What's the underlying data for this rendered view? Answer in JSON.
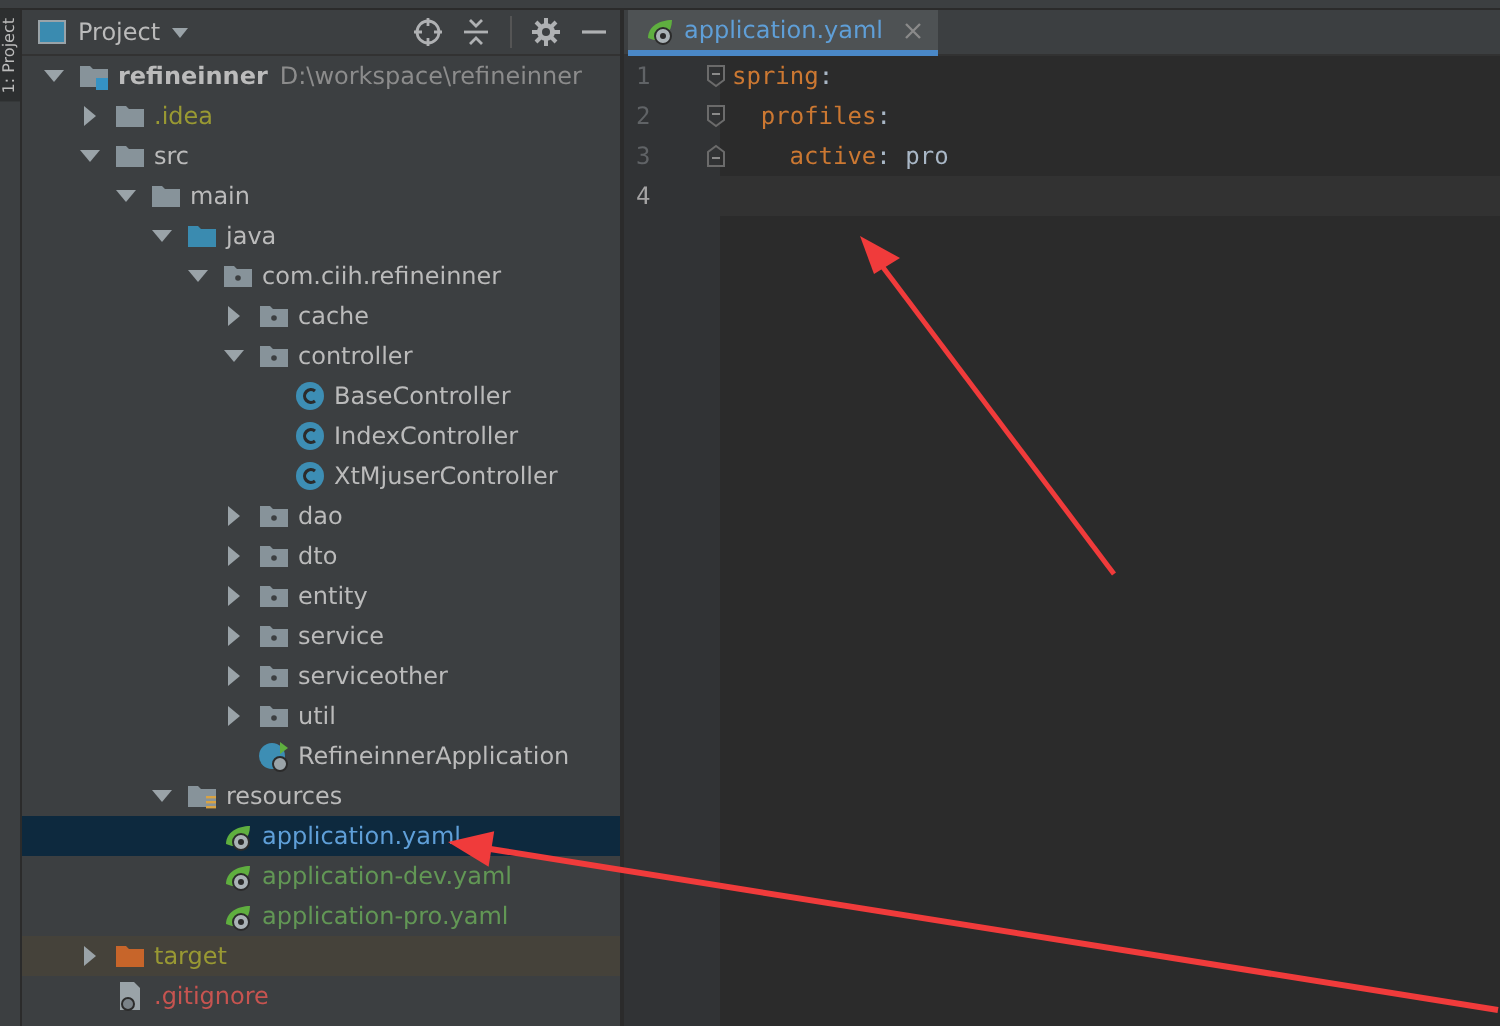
{
  "side_tab": {
    "label": "1: Project"
  },
  "project_panel": {
    "title": "Project",
    "tree": [
      {
        "name": "refineinner",
        "kind": "module",
        "hint": "D:\\workspace\\refineinner",
        "expanded": true,
        "selected": false,
        "color": "#bbbbbb",
        "children": [
          {
            "name": ".idea",
            "kind": "folder",
            "expanded": false,
            "selected": false,
            "color": "#999933"
          },
          {
            "name": "src",
            "kind": "folder",
            "expanded": true,
            "selected": false,
            "color": "#bbbbbb",
            "children": [
              {
                "name": "main",
                "kind": "folder",
                "expanded": true,
                "selected": false,
                "color": "#bbbbbb",
                "children": [
                  {
                    "name": "java",
                    "kind": "source-folder",
                    "expanded": true,
                    "selected": false,
                    "color": "#bbbbbb",
                    "children": [
                      {
                        "name": "com.ciih.refineinner",
                        "kind": "package",
                        "expanded": true,
                        "selected": false,
                        "color": "#bbbbbb",
                        "children": [
                          {
                            "name": "cache",
                            "kind": "package",
                            "expanded": false,
                            "selected": false,
                            "color": "#bbbbbb"
                          },
                          {
                            "name": "controller",
                            "kind": "package",
                            "expanded": true,
                            "selected": false,
                            "color": "#bbbbbb",
                            "children": [
                              {
                                "name": "BaseController",
                                "kind": "class",
                                "selected": false,
                                "color": "#bbbbbb"
                              },
                              {
                                "name": "IndexController",
                                "kind": "class",
                                "selected": false,
                                "color": "#bbbbbb"
                              },
                              {
                                "name": "XtMjuserController",
                                "kind": "class",
                                "selected": false,
                                "color": "#bbbbbb"
                              }
                            ]
                          },
                          {
                            "name": "dao",
                            "kind": "package",
                            "expanded": false,
                            "selected": false,
                            "color": "#bbbbbb"
                          },
                          {
                            "name": "dto",
                            "kind": "package",
                            "expanded": false,
                            "selected": false,
                            "color": "#bbbbbb"
                          },
                          {
                            "name": "entity",
                            "kind": "package",
                            "expanded": false,
                            "selected": false,
                            "color": "#bbbbbb"
                          },
                          {
                            "name": "service",
                            "kind": "package",
                            "expanded": false,
                            "selected": false,
                            "color": "#bbbbbb"
                          },
                          {
                            "name": "serviceother",
                            "kind": "package",
                            "expanded": false,
                            "selected": false,
                            "color": "#bbbbbb"
                          },
                          {
                            "name": "util",
                            "kind": "package",
                            "expanded": false,
                            "selected": false,
                            "color": "#bbbbbb"
                          },
                          {
                            "name": "RefineinnerApplication",
                            "kind": "spring-class",
                            "selected": false,
                            "color": "#bbbbbb"
                          }
                        ]
                      }
                    ]
                  },
                  {
                    "name": "resources",
                    "kind": "resources-folder",
                    "expanded": true,
                    "selected": false,
                    "color": "#bbbbbb",
                    "children": [
                      {
                        "name": "application.yaml",
                        "kind": "yaml",
                        "selected": true,
                        "color": "#5f9fd8"
                      },
                      {
                        "name": "application-dev.yaml",
                        "kind": "yaml",
                        "selected": false,
                        "color": "#629755"
                      },
                      {
                        "name": "application-pro.yaml",
                        "kind": "yaml",
                        "selected": false,
                        "color": "#629755"
                      }
                    ]
                  }
                ]
              }
            ]
          },
          {
            "name": "target",
            "kind": "excluded-folder",
            "expanded": false,
            "selected": false,
            "color": "#999933"
          },
          {
            "name": ".gitignore",
            "kind": "file",
            "selected": false,
            "color": "#c75450"
          }
        ]
      }
    ]
  },
  "editor": {
    "tabs": [
      {
        "label": "application.yaml",
        "selected": true
      }
    ],
    "gutter": [
      {
        "number": "1",
        "current": false
      },
      {
        "number": "2",
        "current": false
      },
      {
        "number": "3",
        "current": false
      },
      {
        "number": "4",
        "current": true
      }
    ],
    "yaml": [
      {
        "key": "spring",
        "colon": ":",
        "children": [
          {
            "key": "profiles",
            "colon": ":",
            "children": [
              {
                "key": "active",
                "colon": ":",
                "value": "pro"
              }
            ]
          }
        ]
      }
    ]
  }
}
